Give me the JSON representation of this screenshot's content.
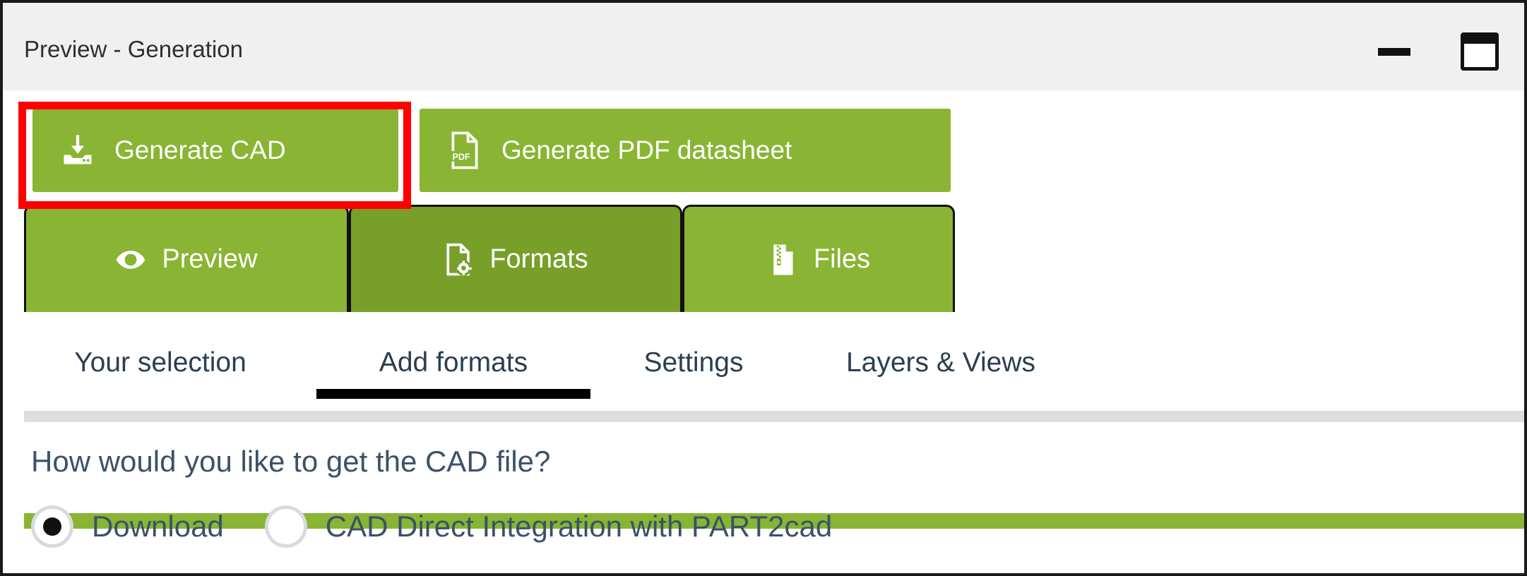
{
  "window": {
    "title": "Preview - Generation",
    "controls": [
      {
        "name": "minimize-button",
        "icon": "minimize-icon"
      },
      {
        "name": "maximize-button",
        "icon": "maximize-icon"
      }
    ]
  },
  "actions": {
    "generate_cad": {
      "label": "Generate CAD",
      "icon": "download-icon"
    },
    "generate_pdf": {
      "label": "Generate PDF datasheet",
      "icon": "pdf-file-icon"
    }
  },
  "tabs": [
    {
      "label": "Preview",
      "icon": "eye-icon",
      "active": false
    },
    {
      "label": "Formats",
      "icon": "file-gear-icon",
      "active": true
    },
    {
      "label": "Files",
      "icon": "file-archive-icon",
      "active": false
    }
  ],
  "subtabs": [
    {
      "label": "Your selection",
      "active": false
    },
    {
      "label": "Add formats",
      "active": true
    },
    {
      "label": "Settings",
      "active": false
    },
    {
      "label": "Layers & Views",
      "active": false
    }
  ],
  "content": {
    "question": "How would you like to get the CAD file?",
    "options": [
      {
        "label": "Download",
        "selected": true
      },
      {
        "label": "CAD Direct Integration with PART2cad",
        "selected": false
      }
    ]
  },
  "colors": {
    "brand_green": "#8ab433",
    "brand_green_active": "#789f28",
    "highlight_red": "#ff0000",
    "titlebar_bg": "#f0f0f0",
    "text_dark": "#3c5169"
  }
}
